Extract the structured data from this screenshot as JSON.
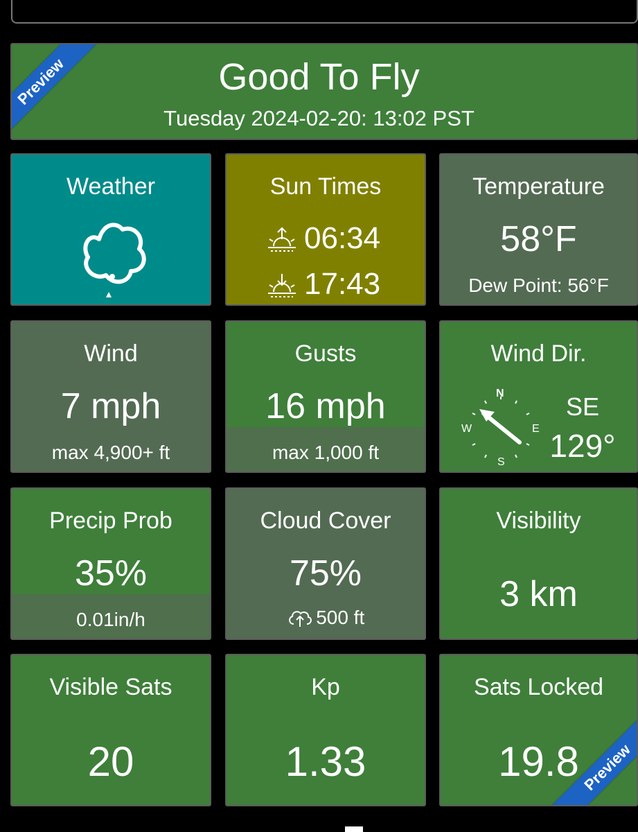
{
  "banner": {
    "title": "Good To Fly",
    "subtitle": "Tuesday 2024-02-20: 13:02 PST",
    "ribbon": "Preview"
  },
  "corner_ribbon": "Preview",
  "tiles": {
    "weather": {
      "label": "Weather",
      "icon": "cloud-icon"
    },
    "sun": {
      "label": "Sun Times",
      "sunrise": "06:34",
      "sunset": "17:43"
    },
    "temperature": {
      "label": "Temperature",
      "value": "58°F",
      "dew": "Dew Point: 56°F"
    },
    "wind": {
      "label": "Wind",
      "value": "7 mph",
      "sub": "max 4,900+ ft"
    },
    "gusts": {
      "label": "Gusts",
      "value": "16 mph",
      "sub": "max 1,000 ft"
    },
    "wind_dir": {
      "label": "Wind Dir.",
      "cardinal": "SE",
      "degrees": "129°",
      "compass": {
        "n": "N",
        "e": "E",
        "s": "S",
        "w": "W"
      }
    },
    "precip": {
      "label": "Precip Prob",
      "value": "35%",
      "sub": "0.01in/h"
    },
    "cloud": {
      "label": "Cloud Cover",
      "value": "75%",
      "sub": "500 ft"
    },
    "visibility": {
      "label": "Visibility",
      "value": "3 km"
    },
    "visible_sats": {
      "label": "Visible Sats",
      "value": "20"
    },
    "kp": {
      "label": "Kp",
      "value": "1.33"
    },
    "sats_locked": {
      "label": "Sats Locked",
      "value": "19.8"
    }
  },
  "colors": {
    "green": "#3f7f3a",
    "gray_green": "#536b53",
    "teal": "#008b8b",
    "olive": "#808000",
    "ribbon": "#1d63c4"
  }
}
